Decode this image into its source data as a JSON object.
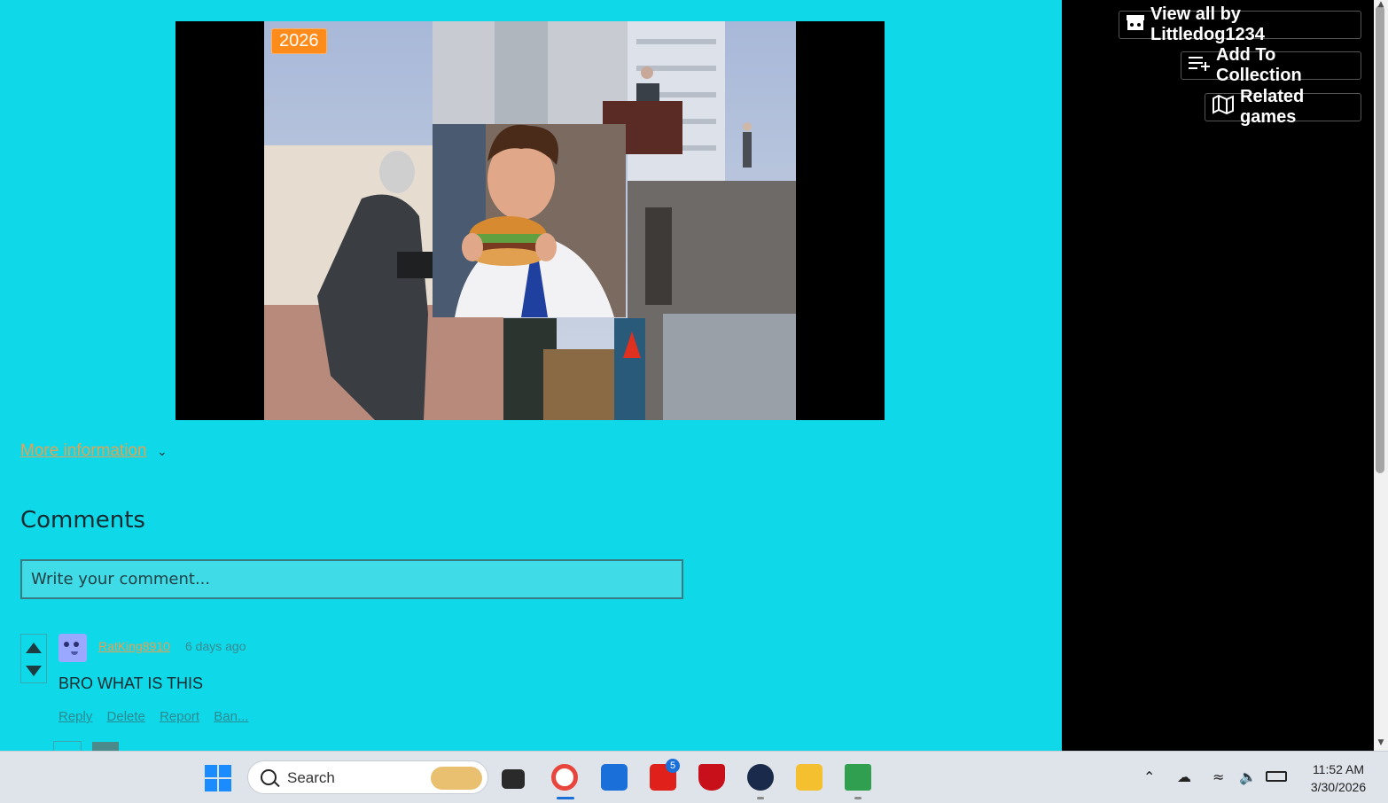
{
  "game": {
    "year_badge": "2026"
  },
  "more_info": {
    "label": "More information"
  },
  "comments": {
    "title": "Comments",
    "placeholder": "Write your comment...",
    "items": [
      {
        "username": "RatKing8910",
        "time": "6 days ago",
        "text": "BRO WHAT IS THIS",
        "actions": [
          "Reply",
          "Delete",
          "Report",
          "Ban..."
        ]
      }
    ]
  },
  "sidebar": {
    "view_all": "View all by Littledog1234",
    "add_to_collection": "Add To Collection",
    "related_games": "Related games"
  },
  "taskbar": {
    "search_label": "Search",
    "mail_badge": "5",
    "time": "11:52 AM",
    "date": "3/30/2026"
  }
}
